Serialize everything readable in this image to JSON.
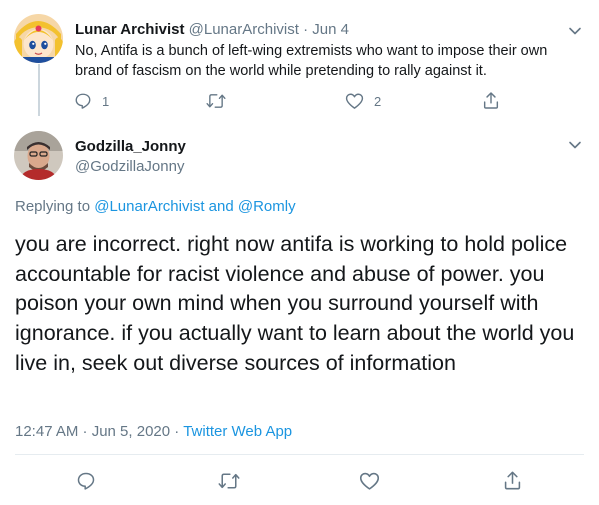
{
  "parent_tweet": {
    "display_name": "Lunar Archivist",
    "handle": "@LunarArchivist",
    "separator": "·",
    "date": "Jun 4",
    "text": "No, Antifa is a bunch of left-wing extremists who want to impose their own brand of fascism on the world while pretending to rally against it.",
    "actions": {
      "reply_icon": "reply-icon",
      "reply_count": "1",
      "retweet_icon": "retweet-icon",
      "like_icon": "heart-icon",
      "like_count": "2",
      "share_icon": "share-icon"
    }
  },
  "main_tweet": {
    "display_name": "Godzilla_Jonny",
    "handle": "@GodzillaJonny",
    "replying_prefix": "Replying to",
    "replying_user_1": "@LunarArchivist",
    "replying_and": "and",
    "replying_user_2": "@Romly",
    "text": "you are incorrect. right now antifa is working to hold police accountable for racist violence and abuse of power. you poison your own mind when you surround yourself with ignorance. if you actually want to learn about the world you live in, seek out diverse sources of information",
    "timestamp": "12:47 AM · Jun 5, 2020",
    "meta_separator": "·",
    "source": "Twitter Web App",
    "actions": {
      "reply_icon": "reply-icon",
      "retweet_icon": "retweet-icon",
      "like_icon": "heart-icon",
      "share_icon": "share-icon"
    }
  },
  "colors": {
    "text": "#14171a",
    "secondary": "#657786",
    "link": "#1b95e0",
    "border": "#e6ecf0"
  }
}
